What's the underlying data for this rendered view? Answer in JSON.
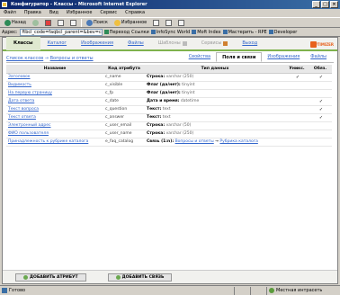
{
  "window": {
    "title": "Конфигуратор - Классы - Microsoft Internet Explorer",
    "controls": [
      "_",
      "□",
      "×"
    ]
  },
  "menu": [
    "Файл",
    "Правка",
    "Вид",
    "Избранное",
    "Сервис",
    "Справка"
  ],
  "toolbar": {
    "back_label": "Назад",
    "search_label": "Поиск",
    "favorites_label": "Избранное"
  },
  "address": {
    "label": "Адрес:",
    "value": "ftbcl_code=faqbcl_parent=&bev=cl_code",
    "go_label": "Переход",
    "links_label": "Ссылки",
    "links": [
      "InfoSync World",
      "Moft Index",
      "Мастерить - RPE",
      "Developer"
    ]
  },
  "nav": {
    "tabs": [
      "Классы",
      "Каталог",
      "Изображения",
      "Файлы",
      "Шаблоны",
      "Сервисы",
      "Выход"
    ],
    "logo": "OPTIMIZER"
  },
  "breadcrumb": {
    "link": "Список классов",
    "sep": " → ",
    "current": "Вопросы и ответы"
  },
  "subtabs": [
    "Свойства",
    "Поля и связи",
    "Изображения",
    "Файлы"
  ],
  "table": {
    "headers": [
      "Название",
      "Код атрибута",
      "Тип данных",
      "Уникс.",
      "Обяз."
    ],
    "rows": [
      {
        "name": "Заголовок",
        "code": "c_name",
        "type_bold": "Строка:",
        "type_rest": "varchar (250)",
        "unique": "✓",
        "required": "✓"
      },
      {
        "name": "Видимость",
        "code": "c_visible",
        "type_bold": "Флаг (да/нет):",
        "type_rest": "tinyint",
        "unique": "",
        "required": ""
      },
      {
        "name": "На первую страницу",
        "code": "c_fp",
        "type_bold": "Флаг (да/нет):",
        "type_rest": "tinyint",
        "unique": "",
        "required": ""
      },
      {
        "name": "Дата ответа",
        "code": "c_date",
        "type_bold": "Дата и время:",
        "type_rest": "datetime",
        "unique": "",
        "required": "✓"
      },
      {
        "name": "Текст вопроса",
        "code": "c_question",
        "type_bold": "Текст:",
        "type_rest": "text",
        "unique": "",
        "required": "✓"
      },
      {
        "name": "Текст ответа",
        "code": "c_answer",
        "type_bold": "Текст:",
        "type_rest": "text",
        "unique": "",
        "required": "✓"
      },
      {
        "name": "Электронный адрес",
        "code": "c_user_email",
        "type_bold": "Строка:",
        "type_rest": "varchar (50)",
        "unique": "",
        "required": ""
      },
      {
        "name": "ФИО пользователя",
        "code": "c_user_name",
        "type_bold": "Строка:",
        "type_rest": "varchar (250)",
        "unique": "",
        "required": ""
      },
      {
        "name": "Принадлежность к рубрике каталога",
        "code": "e_faq_catalog",
        "type_bold": "Связь (1:n):",
        "type_rest": "",
        "link_a": "Вопросы и ответы",
        "arrow": " → ",
        "link_b": "Рубрика каталога",
        "unique": "",
        "required": ""
      }
    ]
  },
  "actions": {
    "add_attr": "ДОБАВИТЬ АТРИБУТ",
    "add_link": "ДОБАВИТЬ СВЯЗЬ"
  },
  "status": {
    "left": "Готово",
    "zone": "Местная интрасеть"
  }
}
